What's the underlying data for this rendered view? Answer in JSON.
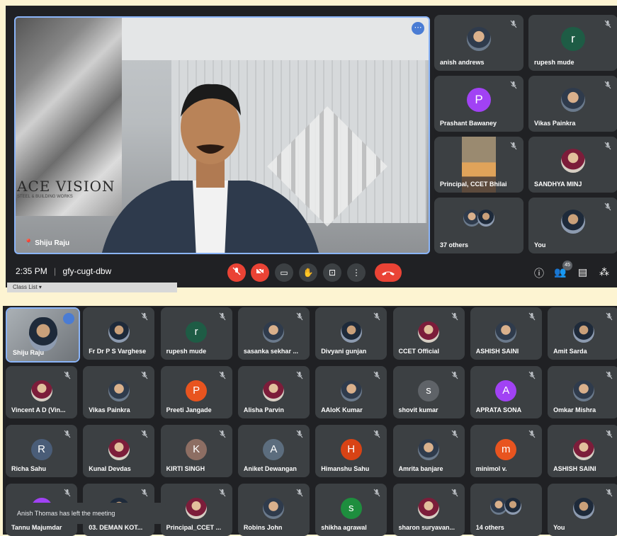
{
  "meeting": {
    "time": "2:35 PM",
    "code": "gfy-cugt-dbw",
    "separator": "|",
    "participant_badge": "45",
    "class_list_label": "Class List"
  },
  "speaker": {
    "name": "Shiju Raju",
    "logo_text": "ACE VISION",
    "logo_sub": "STEEL & BUILDING WORKS"
  },
  "top_grid": [
    {
      "name": "anish andrews",
      "avatar": "photo"
    },
    {
      "name": "rupesh mude",
      "avatar": "r",
      "color": "#1e5c45"
    },
    {
      "name": "Prashant Bawaney",
      "avatar": "P",
      "color": "#a142f4"
    },
    {
      "name": "Vikas Painkra",
      "avatar": "photo"
    },
    {
      "name": "Principal, CCET Bhilai",
      "avatar": "video"
    },
    {
      "name": "SANDHYA MINJ",
      "avatar": "photo"
    },
    {
      "name": "37 others",
      "avatar": "group"
    },
    {
      "name": "You",
      "avatar": "photo"
    }
  ],
  "bottom_grid": [
    {
      "name": "Shiju Raju",
      "avatar": "self"
    },
    {
      "name": "Fr Dr P S Varghese",
      "avatar": "photo"
    },
    {
      "name": "rupesh mude",
      "avatar": "r",
      "color": "#1e5c45"
    },
    {
      "name": "sasanka sekhar ...",
      "avatar": "photo"
    },
    {
      "name": "Divyani gunjan",
      "avatar": "photo"
    },
    {
      "name": "CCET Official",
      "avatar": "photo"
    },
    {
      "name": "ASHISH SAINI",
      "avatar": "photo"
    },
    {
      "name": "Amit Sarda",
      "avatar": "photo"
    },
    {
      "name": "Vincent A D (Vin...",
      "avatar": "photo"
    },
    {
      "name": "Vikas Painkra",
      "avatar": "photo"
    },
    {
      "name": "Preeti Jangade",
      "avatar": "P",
      "color": "#e8541f"
    },
    {
      "name": "Alisha Parvin",
      "avatar": "photo"
    },
    {
      "name": "AAloK Kumar",
      "avatar": "photo"
    },
    {
      "name": "shovit kumar",
      "avatar": "s",
      "color": "#5f6368"
    },
    {
      "name": "APRATA SONA",
      "avatar": "A",
      "color": "#a142f4"
    },
    {
      "name": "Omkar Mishra",
      "avatar": "photo"
    },
    {
      "name": "Richa Sahu",
      "avatar": "R",
      "color": "#4a5d78"
    },
    {
      "name": "Kunal Devdas",
      "avatar": "photo"
    },
    {
      "name": "KIRTI SINGH",
      "avatar": "K",
      "color": "#8d6e63"
    },
    {
      "name": "Aniket Dewangan",
      "avatar": "A",
      "color": "#5c6d7e"
    },
    {
      "name": "Himanshu Sahu",
      "avatar": "H",
      "color": "#d84315"
    },
    {
      "name": "Amrita banjare",
      "avatar": "photo"
    },
    {
      "name": "minimol v.",
      "avatar": "m",
      "color": "#e8541f"
    },
    {
      "name": "ASHISH SAINI",
      "avatar": "photo"
    },
    {
      "name": "Tannu Majumdar",
      "avatar": "T",
      "color": "#a142f4"
    },
    {
      "name": "03. DEMAN KOT...",
      "avatar": "photo"
    },
    {
      "name": "Principal_CCET ...",
      "avatar": "photo"
    },
    {
      "name": "Robins John",
      "avatar": "photo"
    },
    {
      "name": "shikha agrawal",
      "avatar": "s",
      "color": "#1e8e3e"
    },
    {
      "name": "sharon suryavan...",
      "avatar": "photo"
    },
    {
      "name": "14 others",
      "avatar": "group"
    },
    {
      "name": "You",
      "avatar": "photo"
    }
  ],
  "toast": "Anish Thomas has left the meeting",
  "colors": {
    "panel": "#202124",
    "tile": "#3c4043",
    "accent": "#8ab4f8",
    "danger": "#ea4335",
    "frame": "#fdf4d2"
  }
}
